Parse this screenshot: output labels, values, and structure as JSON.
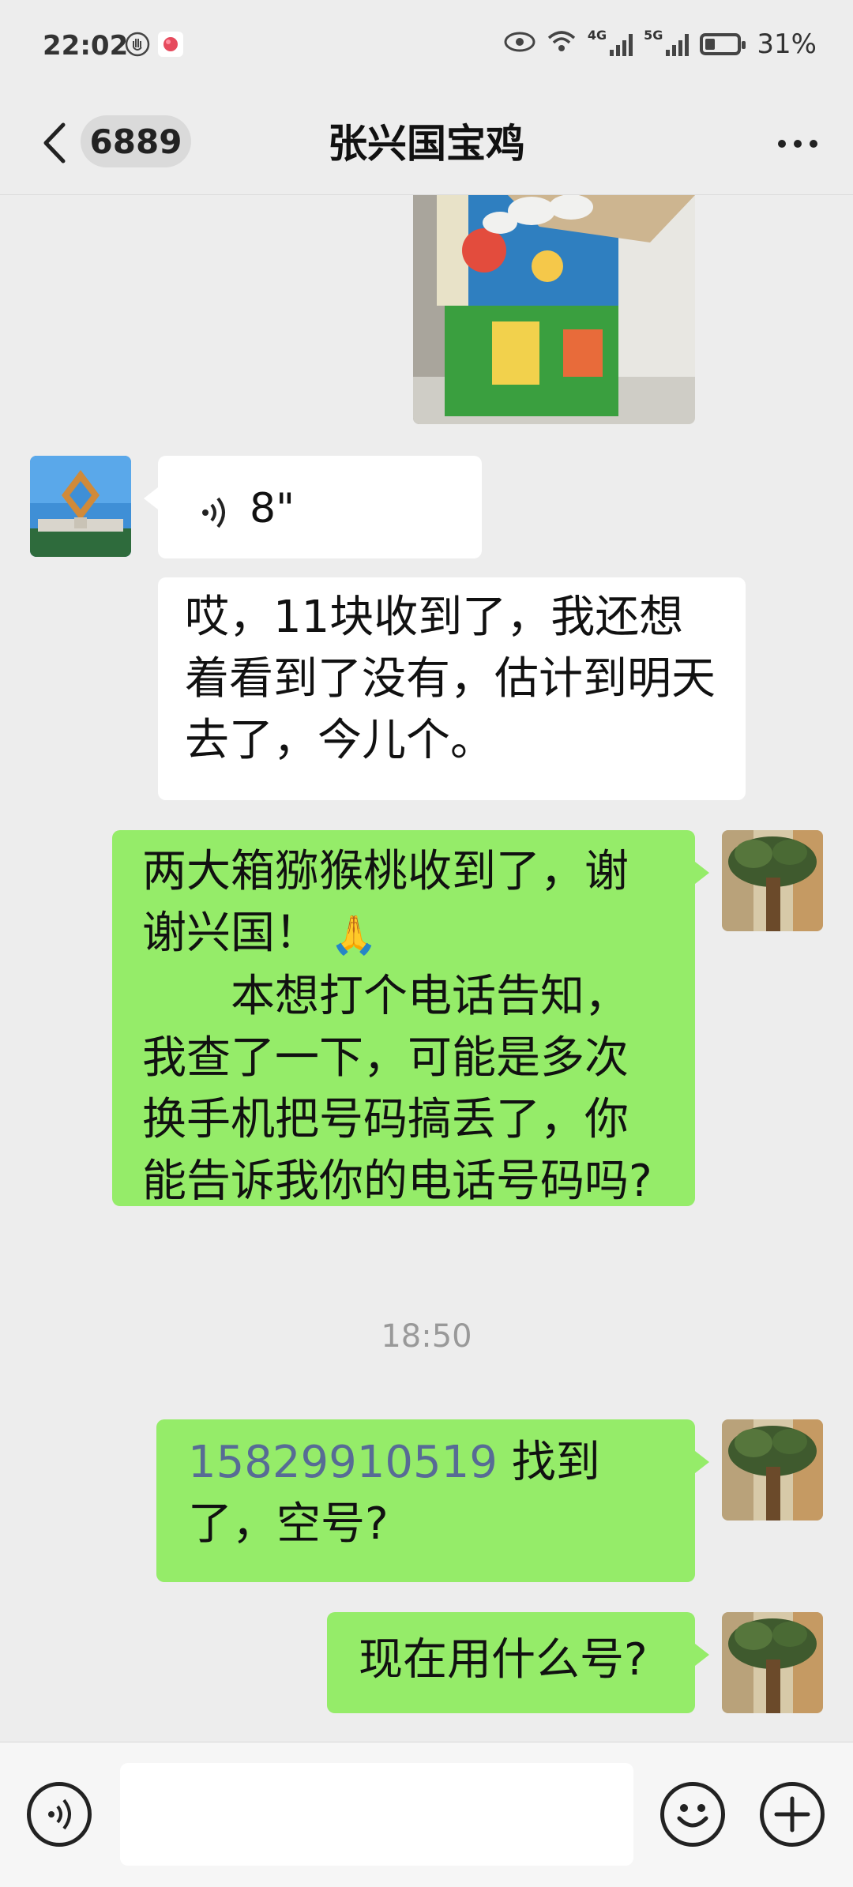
{
  "status_bar": {
    "time": "22:02",
    "battery_percent": "31%",
    "battery_level": 0.31,
    "network_4g": "4G",
    "network_5g": "5G"
  },
  "header": {
    "back_icon": "chevron-left-icon",
    "unread_count": "6889",
    "title": "张兴国宝鸡",
    "more_icon": "more-dots-icon"
  },
  "messages": [
    {
      "type": "image",
      "direction": "out"
    },
    {
      "type": "voice",
      "direction": "in",
      "duration": "8\""
    },
    {
      "type": "text",
      "direction": "in",
      "text": "哎，11块收到了，我还想着看到了没有，估计到明天去了，今儿个。"
    },
    {
      "type": "text",
      "direction": "out",
      "line1": "两大箱猕猴桃收到了，谢谢兴国！",
      "emoji": "🙏",
      "line2": "本想打个电话告知，我查了一下，可能是多次换手机把号码搞丢了，你能告诉我你的电话号码吗?"
    },
    {
      "type": "time",
      "text": "18:50"
    },
    {
      "type": "text",
      "direction": "out",
      "phone": "15829910519",
      "text": " 找到了，空号?"
    },
    {
      "type": "text",
      "direction": "out",
      "text": "现在用什么号?"
    }
  ],
  "input_bar": {
    "voice_icon": "voice-icon",
    "emoji_icon": "emoji-icon",
    "plus_icon": "plus-icon",
    "input_value": ""
  },
  "colors": {
    "background": "#ededed",
    "outgoing_bubble": "#95ec69",
    "incoming_bubble": "#ffffff",
    "link": "#576b95"
  }
}
